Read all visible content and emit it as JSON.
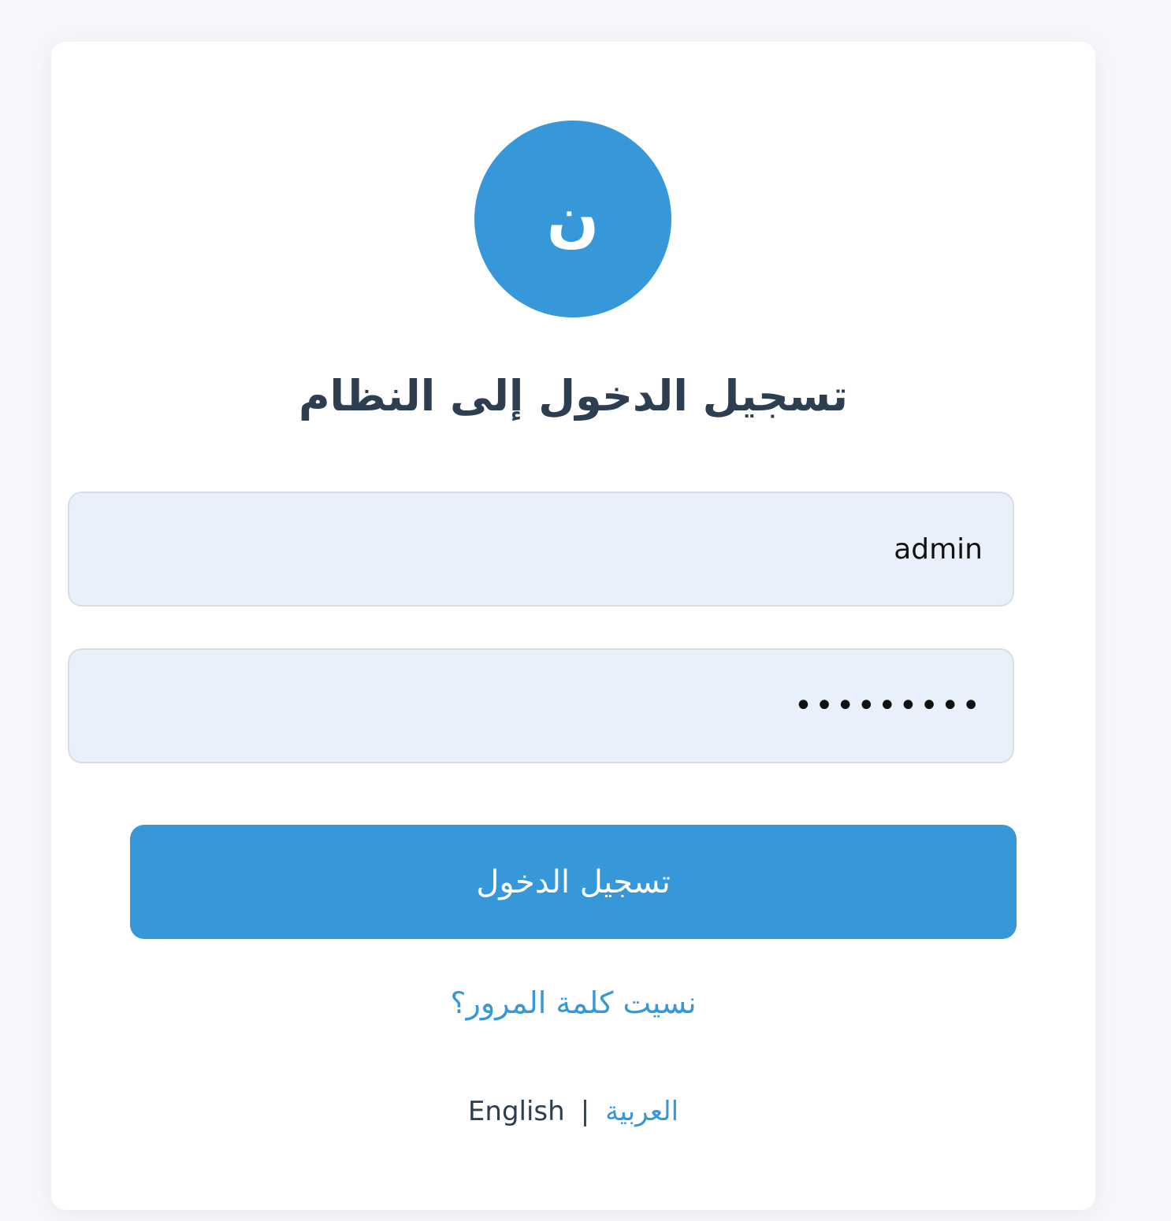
{
  "logo": {
    "letter": "ن"
  },
  "title": "تسجيل الدخول إلى النظام",
  "form": {
    "username_value": "admin",
    "password_value": "•••••••••",
    "submit_label": "تسجيل الدخول"
  },
  "forgot_password_label": "نسيت كلمة المرور؟",
  "language": {
    "arabic_label": "العربية",
    "separator": "|",
    "english_label": "English"
  },
  "colors": {
    "accent": "#3798d9",
    "input_bg": "#e8f0fb",
    "heading": "#2c3e50",
    "page_bg": "#f5f7fa"
  }
}
